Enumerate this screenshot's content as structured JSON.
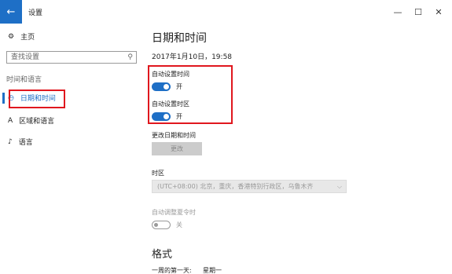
{
  "window": {
    "back_glyph": "←",
    "title": "设置",
    "minimize": "—",
    "maximize": "☐",
    "close": "✕"
  },
  "sidebar": {
    "home_icon": "⚙",
    "home_label": "主页",
    "search_placeholder": "查找设置",
    "search_icon": "⚲",
    "section": "时间和语言",
    "items": [
      {
        "icon": "◷",
        "label": "日期和时间",
        "active": true
      },
      {
        "icon": "A",
        "label": "区域和语言",
        "active": false
      },
      {
        "icon": "♪",
        "label": "语言",
        "active": false
      }
    ]
  },
  "main": {
    "title": "日期和时间",
    "datetime": "2017年1月10日，19:58",
    "auto_time_label": "自动设置时间",
    "auto_time_state": "开",
    "auto_tz_label": "自动设置时区",
    "auto_tz_state": "开",
    "change_label": "更改日期和时间",
    "change_button": "更改",
    "timezone_label": "时区",
    "timezone_value": "(UTC+08:00) 北京，重庆，香港特别行政区，乌鲁木齐",
    "dst_label": "自动调整夏令时",
    "dst_state": "关",
    "format_heading": "格式",
    "first_day_label": "一周的第一天:",
    "first_day_value": "星期一"
  },
  "colors": {
    "accent": "#1e6fc6",
    "highlight_box": "#e0171e"
  }
}
